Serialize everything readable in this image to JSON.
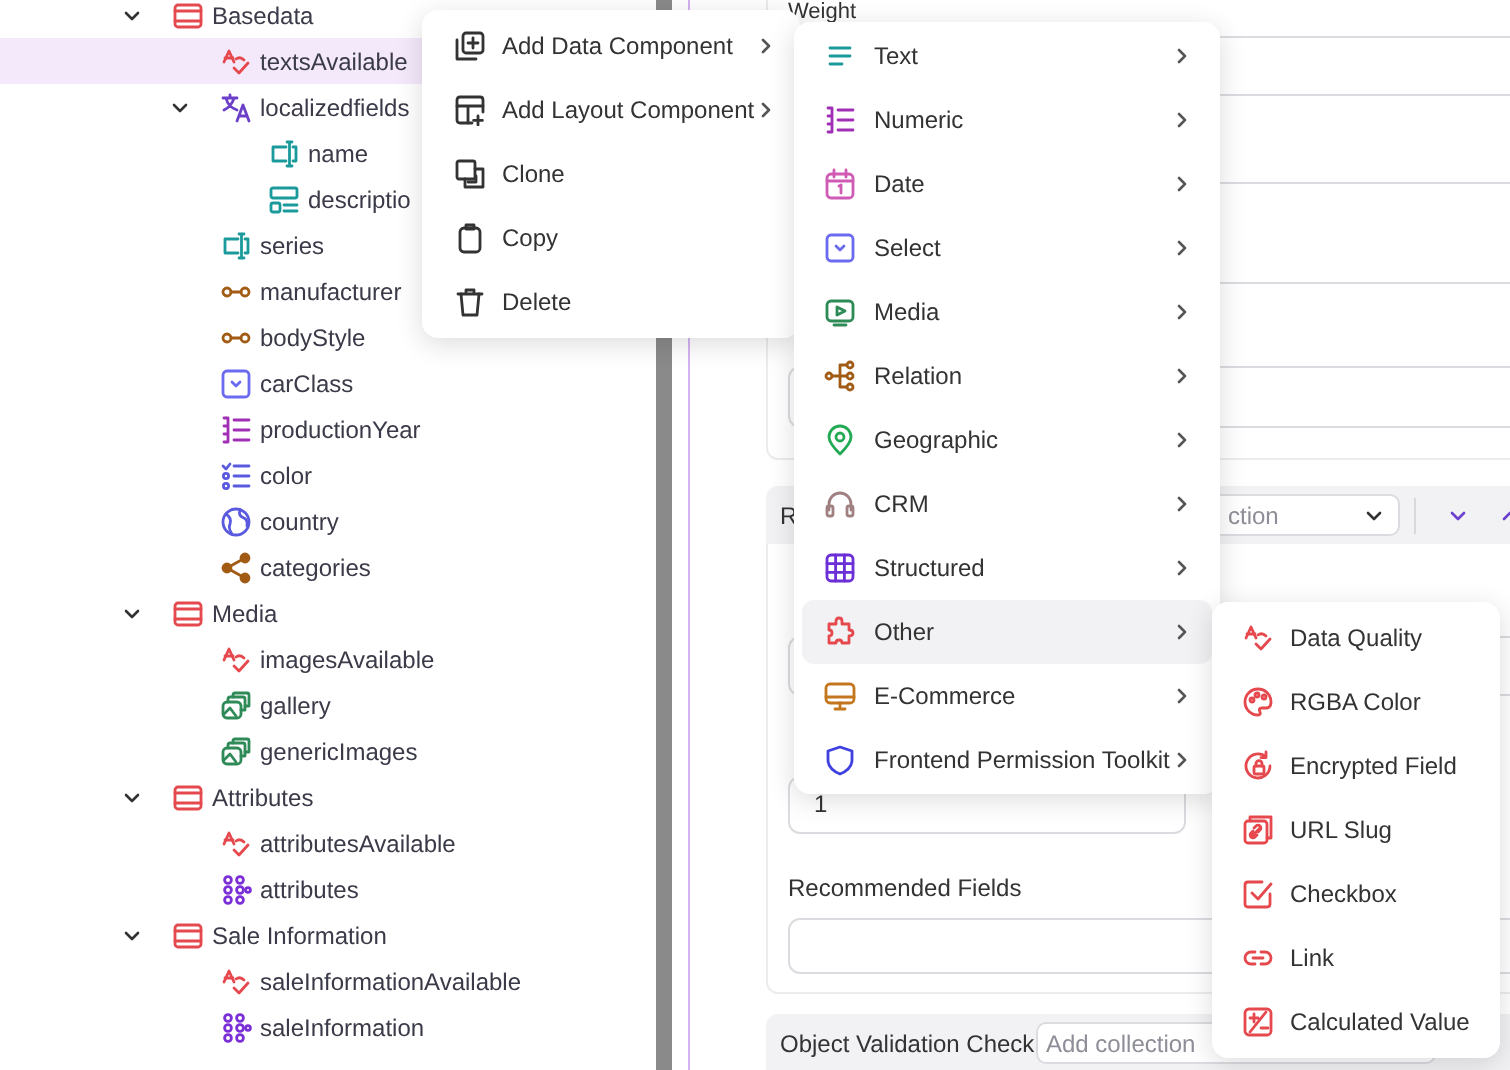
{
  "tree": [
    {
      "label": "Basedata",
      "kind": "block",
      "expanded": true,
      "selected": false,
      "children": [
        {
          "label": "textsAvailable",
          "kind": "quality",
          "selected": true
        },
        {
          "label": "localizedfields",
          "kind": "localized",
          "expanded": true,
          "selected": false,
          "children": [
            {
              "label": "name",
              "kind": "input",
              "selected": false
            },
            {
              "label": "descriptio",
              "kind": "textarea",
              "selected": false
            }
          ]
        },
        {
          "label": "series",
          "kind": "input",
          "selected": false
        },
        {
          "label": "manufacturer",
          "kind": "relation",
          "selected": false
        },
        {
          "label": "bodyStyle",
          "kind": "relation",
          "selected": false
        },
        {
          "label": "carClass",
          "kind": "select",
          "selected": false
        },
        {
          "label": "productionYear",
          "kind": "numeric",
          "selected": false
        },
        {
          "label": "color",
          "kind": "multiselect",
          "selected": false
        },
        {
          "label": "country",
          "kind": "country",
          "selected": false
        },
        {
          "label": "categories",
          "kind": "categories",
          "selected": false
        }
      ]
    },
    {
      "label": "Media",
      "kind": "block",
      "expanded": true,
      "selected": false,
      "children": [
        {
          "label": "imagesAvailable",
          "kind": "quality",
          "selected": false
        },
        {
          "label": "gallery",
          "kind": "gallery",
          "selected": false
        },
        {
          "label": "genericImages",
          "kind": "gallery",
          "selected": false
        }
      ]
    },
    {
      "label": "Attributes",
      "kind": "block",
      "expanded": true,
      "selected": false,
      "children": [
        {
          "label": "attributesAvailable",
          "kind": "quality",
          "selected": false
        },
        {
          "label": "attributes",
          "kind": "structured",
          "selected": false
        }
      ]
    },
    {
      "label": "Sale Information",
      "kind": "block",
      "expanded": true,
      "selected": false,
      "children": [
        {
          "label": "saleInformationAvailable",
          "kind": "quality",
          "selected": false
        },
        {
          "label": "saleInformation",
          "kind": "structured",
          "selected": false
        }
      ]
    }
  ],
  "editor": {
    "weight_label": "Weight",
    "collection_bar": {
      "title": "R",
      "placeholder": "ction"
    },
    "quantity_value": "1",
    "recommended_label": "Recommended Fields",
    "validation_bar": {
      "title": "Object Validation Check",
      "placeholder": "Add collection"
    }
  },
  "context_menu": {
    "items": [
      {
        "label": "Add Data Component",
        "kind": "add-data",
        "submenu": true
      },
      {
        "label": "Add Layout Component",
        "kind": "add-layout",
        "submenu": true
      },
      {
        "label": "Clone",
        "kind": "clone",
        "submenu": false
      },
      {
        "label": "Copy",
        "kind": "copy",
        "submenu": false
      },
      {
        "label": "Delete",
        "kind": "delete",
        "submenu": false
      }
    ]
  },
  "data_component_menu": {
    "items": [
      {
        "label": "Text",
        "kind": "text",
        "selected": false
      },
      {
        "label": "Numeric",
        "kind": "numeric",
        "selected": false
      },
      {
        "label": "Date",
        "kind": "date",
        "selected": false
      },
      {
        "label": "Select",
        "kind": "select",
        "selected": false
      },
      {
        "label": "Media",
        "kind": "media",
        "selected": false
      },
      {
        "label": "Relation",
        "kind": "relation",
        "selected": false
      },
      {
        "label": "Geographic",
        "kind": "geographic",
        "selected": false
      },
      {
        "label": "CRM",
        "kind": "crm",
        "selected": false
      },
      {
        "label": "Structured",
        "kind": "structured",
        "selected": false
      },
      {
        "label": "Other",
        "kind": "other",
        "selected": true
      },
      {
        "label": "E-Commerce",
        "kind": "ecommerce",
        "selected": false
      },
      {
        "label": "Frontend Permission Toolkit",
        "kind": "frontend",
        "selected": false
      }
    ]
  },
  "other_menu": {
    "items": [
      {
        "label": "Data Quality",
        "kind": "quality"
      },
      {
        "label": "RGBA Color",
        "kind": "rgba"
      },
      {
        "label": "Encrypted Field",
        "kind": "encrypted"
      },
      {
        "label": "URL Slug",
        "kind": "url"
      },
      {
        "label": "Checkbox",
        "kind": "checkbox"
      },
      {
        "label": "Link",
        "kind": "link"
      },
      {
        "label": "Calculated Value",
        "kind": "calculated"
      }
    ]
  }
}
